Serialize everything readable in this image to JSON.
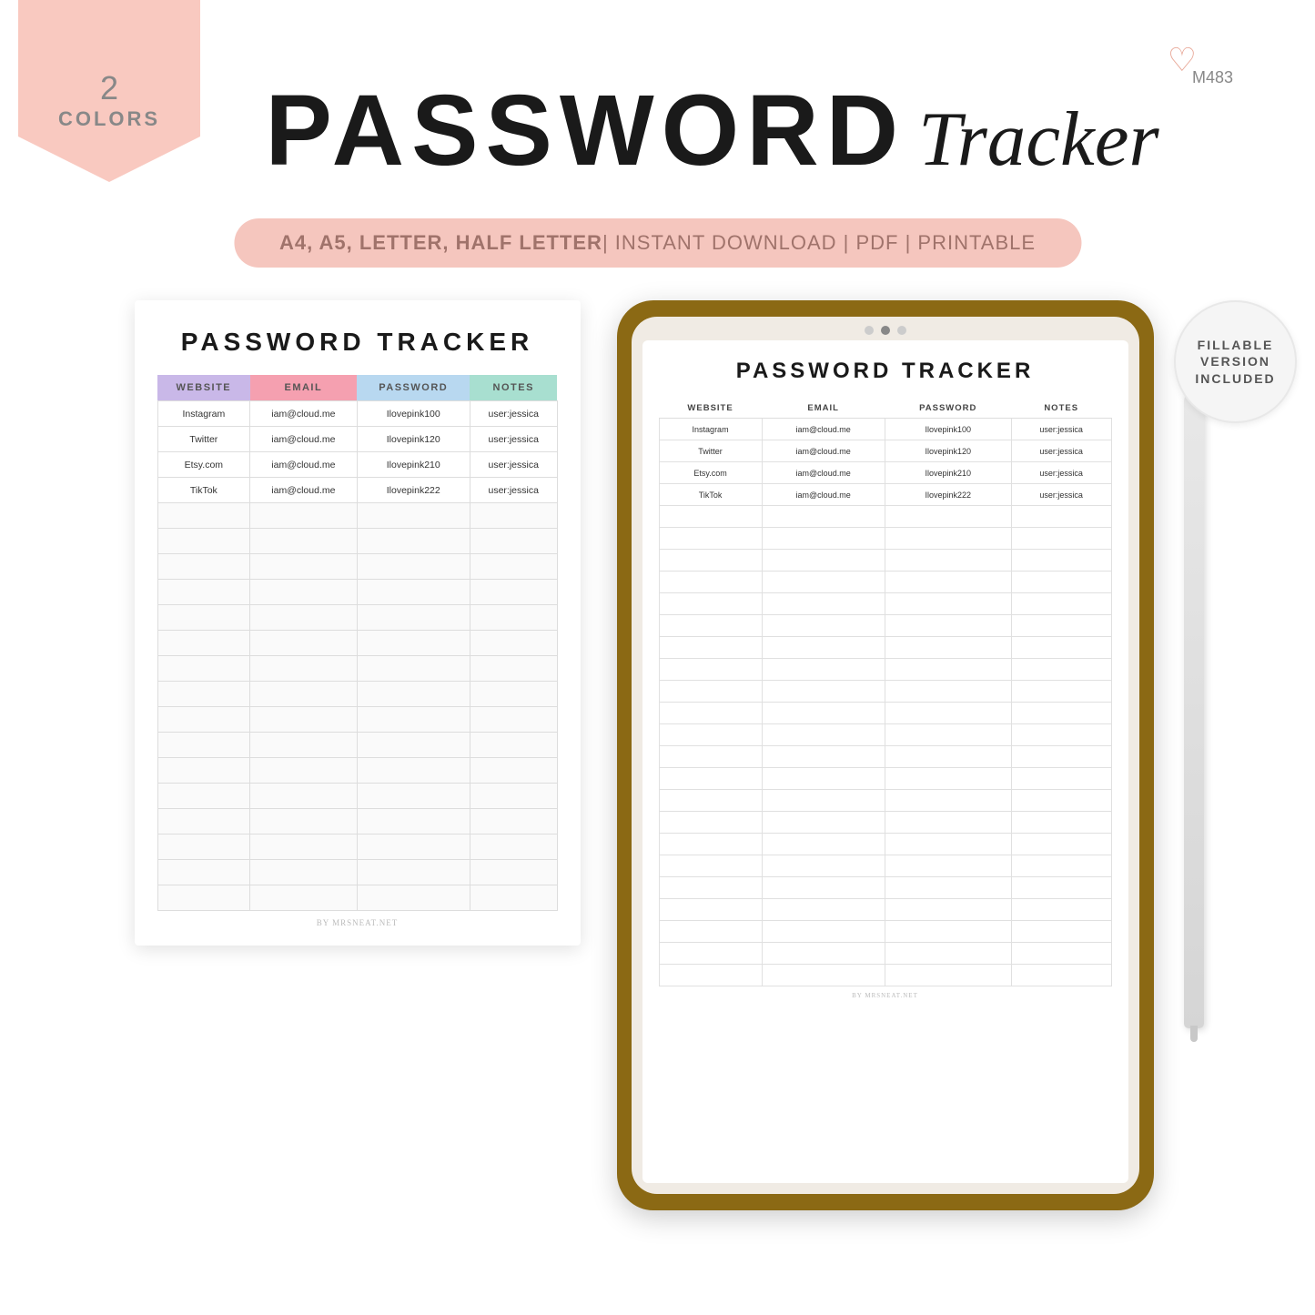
{
  "banner": {
    "number": "2",
    "label": "COLORS"
  },
  "header": {
    "title_part1": "PASSWORD",
    "title_part2": "Tracker",
    "product_code": "M483",
    "subtitle": "A4, A5, LETTER, HALF LETTER",
    "subtitle_light": "| INSTANT DOWNLOAD | PDF | PRINTABLE"
  },
  "fillable_badge": {
    "line1": "FILLABLE",
    "line2": "VERSION",
    "line3": "INCLUDED"
  },
  "paper_doc": {
    "title": "PASSWORD TRACKER",
    "columns": [
      "WEBSITE",
      "EMAIL",
      "PASSWORD",
      "NOTES"
    ],
    "data_rows": [
      [
        "Instagram",
        "iam@cloud.me",
        "Ilovepink100",
        "user:jessica"
      ],
      [
        "Twitter",
        "iam@cloud.me",
        "Ilovepink120",
        "user:jessica"
      ],
      [
        "Etsy.com",
        "iam@cloud.me",
        "Ilovepink210",
        "user:jessica"
      ],
      [
        "TikTok",
        "iam@cloud.me",
        "Ilovepink222",
        "user:jessica"
      ]
    ],
    "empty_rows": 16,
    "footer": "BY MRSNEAT.NET"
  },
  "tablet_doc": {
    "title": "PASSWORD TRACKER",
    "columns": [
      "WEBSITE",
      "EMAIL",
      "PASSWORD",
      "NOTES"
    ],
    "data_rows": [
      [
        "Instagram",
        "iam@cloud.me",
        "Ilovepink100",
        "user:jessica"
      ],
      [
        "Twitter",
        "iam@cloud.me",
        "Ilovepink120",
        "user:jessica"
      ],
      [
        "Etsy.com",
        "iam@cloud.me",
        "Ilovepink210",
        "user:jessica"
      ],
      [
        "TikTok",
        "iam@cloud.me",
        "Ilovepink222",
        "user:jessica"
      ]
    ],
    "empty_rows": 22,
    "footer": "BY MRSNEAT.NET"
  }
}
